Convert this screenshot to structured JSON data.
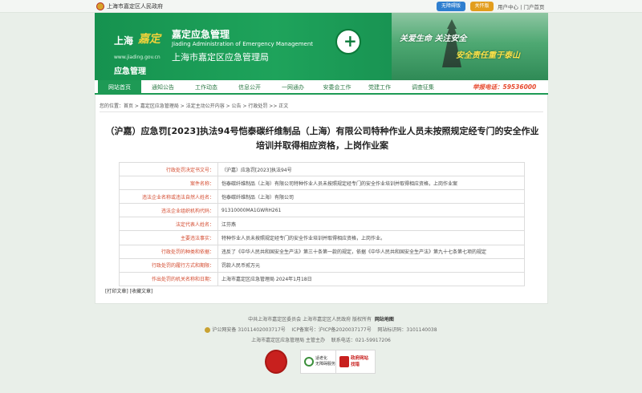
{
  "topbar": {
    "site_name": "上海市嘉定区人民政府",
    "btn_barrier_free": "无障碍版",
    "btn_elder": "关怀版",
    "links": [
      "用户中心",
      "门户首页"
    ]
  },
  "banner": {
    "logo_city": "上海",
    "logo_char": "嘉定",
    "logo_url": "www.jiading.gov.cn",
    "logo_name": "应急管理",
    "title_cn": "嘉定应急管理",
    "title_en": "Jiading Administration of Emergency Management",
    "title_agency": "上海市嘉定区应急管理局",
    "slogan1": "关爱生命  关注安全",
    "slogan2": "安全责任重于泰山"
  },
  "nav": {
    "items": [
      "网站首页",
      "通知公告",
      "工作动态",
      "信息公开",
      "一网通办",
      "安委会工作",
      "党建工作",
      "调查征集"
    ],
    "hotline": "举报电话：59536000"
  },
  "breadcrumb": {
    "prefix": "您的位置：",
    "path": "首页 > 嘉定区应急管理局 > 法定主动公开内容 > 公告 > 行政处罚 >> 正文"
  },
  "article": {
    "title": "（沪嘉）应急罚[2023]执法94号恺泰碳纤维制品（上海）有限公司特种作业人员未按照规定经专门的安全作业培训并取得相应资格，上岗作业案",
    "rows": [
      {
        "label": "行政处罚决定书文号：",
        "value": "（沪嘉）应急罚[2023]执法94号"
      },
      {
        "label": "案件名称：",
        "value": "恺泰碳纤维制品（上海）有限公司特种作业人员未按照规定经专门的安全作业培训并取得相应资格，上岗作业案"
      },
      {
        "label": "违法企业名称或违法自然人姓名：",
        "value": "恺泰碳纤维制品（上海）有限公司"
      },
      {
        "label": "违法企业组织机构代码：",
        "value": "91310000MA1GWRH261"
      },
      {
        "label": "法定代表人姓名：",
        "value": "江芬燕"
      },
      {
        "label": "主要违法事实：",
        "value": "特种作业人员未按照规定经专门的安全作业培训并取得相应资格，上岗作业。"
      },
      {
        "label": "行政处罚的种类和依据：",
        "value": "违反了《中华人民共和国安全生产法》第三十条第一款的规定，依据《中华人民共和国安全生产法》第九十七条第七项的规定"
      },
      {
        "label": "行政处罚的履行方式和期限：",
        "value": "罚款人民币贰万元"
      },
      {
        "label": "作出处罚的机关名称和日期：",
        "value": "上海市嘉定区应急管理局 2024年1月18日"
      }
    ],
    "print_label": "[打印文章]",
    "fav_label": "[收藏文章]"
  },
  "footer": {
    "line1": "中共上海市嘉定区委员会  上海市嘉定区人民政府  版权所有",
    "sitemap": "网站地图",
    "police": "沪公网安备 31011402003717号",
    "icp": "ICP备案号：沪ICP备2020037177号",
    "site_code": "网站标识码：3101140038",
    "host": "上海市嘉定区应急管理局 主管主办",
    "phone": "联系电话：021-59917206",
    "badge2": "适老化\n无障碍服务",
    "badge3": "政府网站\n找错"
  },
  "colors": {
    "brand_green": "#1e9a55",
    "label_red": "#d34a2e",
    "hotline_red": "#e74a2f"
  }
}
